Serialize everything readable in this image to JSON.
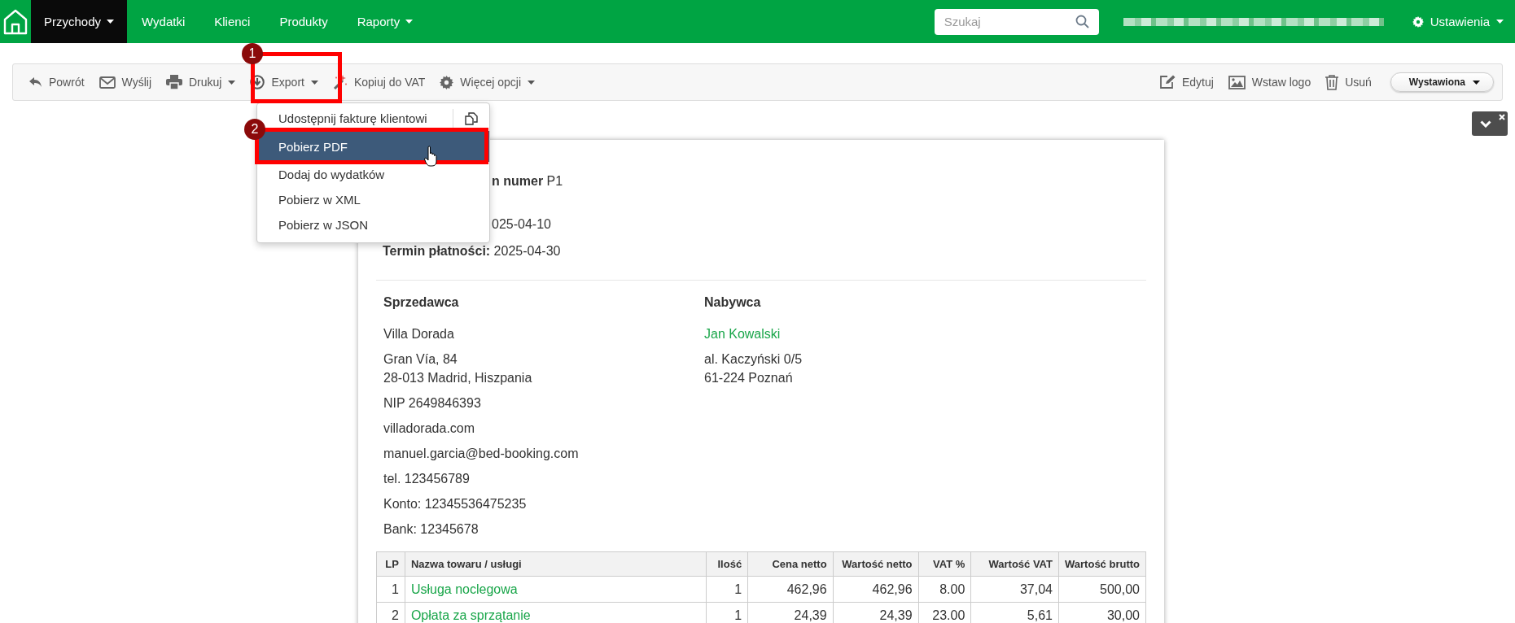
{
  "nav": {
    "items": [
      {
        "label": "Przychody",
        "caret": true,
        "selected": true
      },
      {
        "label": "Wydatki",
        "caret": false,
        "selected": false
      },
      {
        "label": "Klienci",
        "caret": false,
        "selected": false
      },
      {
        "label": "Produkty",
        "caret": false,
        "selected": false
      },
      {
        "label": "Raporty",
        "caret": true,
        "selected": false
      }
    ],
    "search": {
      "placeholder": "Szukaj"
    },
    "settings": "Ustawienia"
  },
  "toolbar": {
    "left": [
      {
        "label": "Powrót",
        "caret": false
      },
      {
        "label": "Wyślij",
        "caret": false
      },
      {
        "label": "Drukuj",
        "caret": true
      },
      {
        "label": "Export",
        "caret": true
      },
      {
        "label": "Kopiuj do VAT",
        "caret": false
      },
      {
        "label": "Więcej opcji",
        "caret": true
      }
    ],
    "right": [
      {
        "label": "Edytuj"
      },
      {
        "label": "Wstaw logo"
      },
      {
        "label": "Usuń"
      }
    ],
    "status": "Wystawiona"
  },
  "export_menu": {
    "items": [
      {
        "label": "Udostępnij fakturę klientowi",
        "selected": false
      },
      {
        "label": "Pobierz PDF",
        "selected": true
      },
      {
        "label": "Dodaj do wydatków",
        "selected": false
      },
      {
        "label": "Pobierz w XML",
        "selected": false
      },
      {
        "label": "Pobierz w JSON",
        "selected": false
      }
    ]
  },
  "annotations": [
    {
      "label": "1"
    },
    {
      "label": "2"
    }
  ],
  "invoice": {
    "header_lines": [
      {
        "text": "**n numer** P1",
        "kind": "covered"
      },
      {
        "text": "025-04-10",
        "kind": "covered"
      },
      {
        "text": "**Termin płatności:** 2025-04-30",
        "kind": "plain"
      }
    ],
    "seller": {
      "title": "Sprzedawca",
      "paragraphs": [
        [
          "Villa Dorada"
        ],
        [
          "Gran Vía, 84",
          "28-013 Madrid, Hiszpania"
        ],
        [
          "NIP 2649846393"
        ],
        [
          "villadorada.com"
        ],
        [
          "manuel.garcia@bed-booking.com"
        ],
        [
          "tel. 123456789"
        ],
        [
          "Konto: 12345536475235"
        ],
        [
          "Bank: 12345678"
        ]
      ]
    },
    "buyer": {
      "title": "Nabywca",
      "name": "Jan Kowalski",
      "paragraphs": [
        [
          "al. Kaczyński 0/5",
          "61-224 Poznań"
        ]
      ]
    },
    "table": {
      "columns": [
        "LP",
        "Nazwa towaru / usługi",
        "Ilość",
        "Cena netto",
        "Wartość netto",
        "VAT %",
        "Wartość VAT",
        "Wartość brutto"
      ],
      "rows": [
        [
          "1",
          "Usługa noclegowa",
          "1",
          "462,96",
          "462,96",
          "8.00",
          "37,04",
          "500,00"
        ],
        [
          "2",
          "Opłata za sprzątanie",
          "1",
          "24,39",
          "24,39",
          "23.00",
          "5,61",
          "30,00"
        ]
      ]
    }
  }
}
